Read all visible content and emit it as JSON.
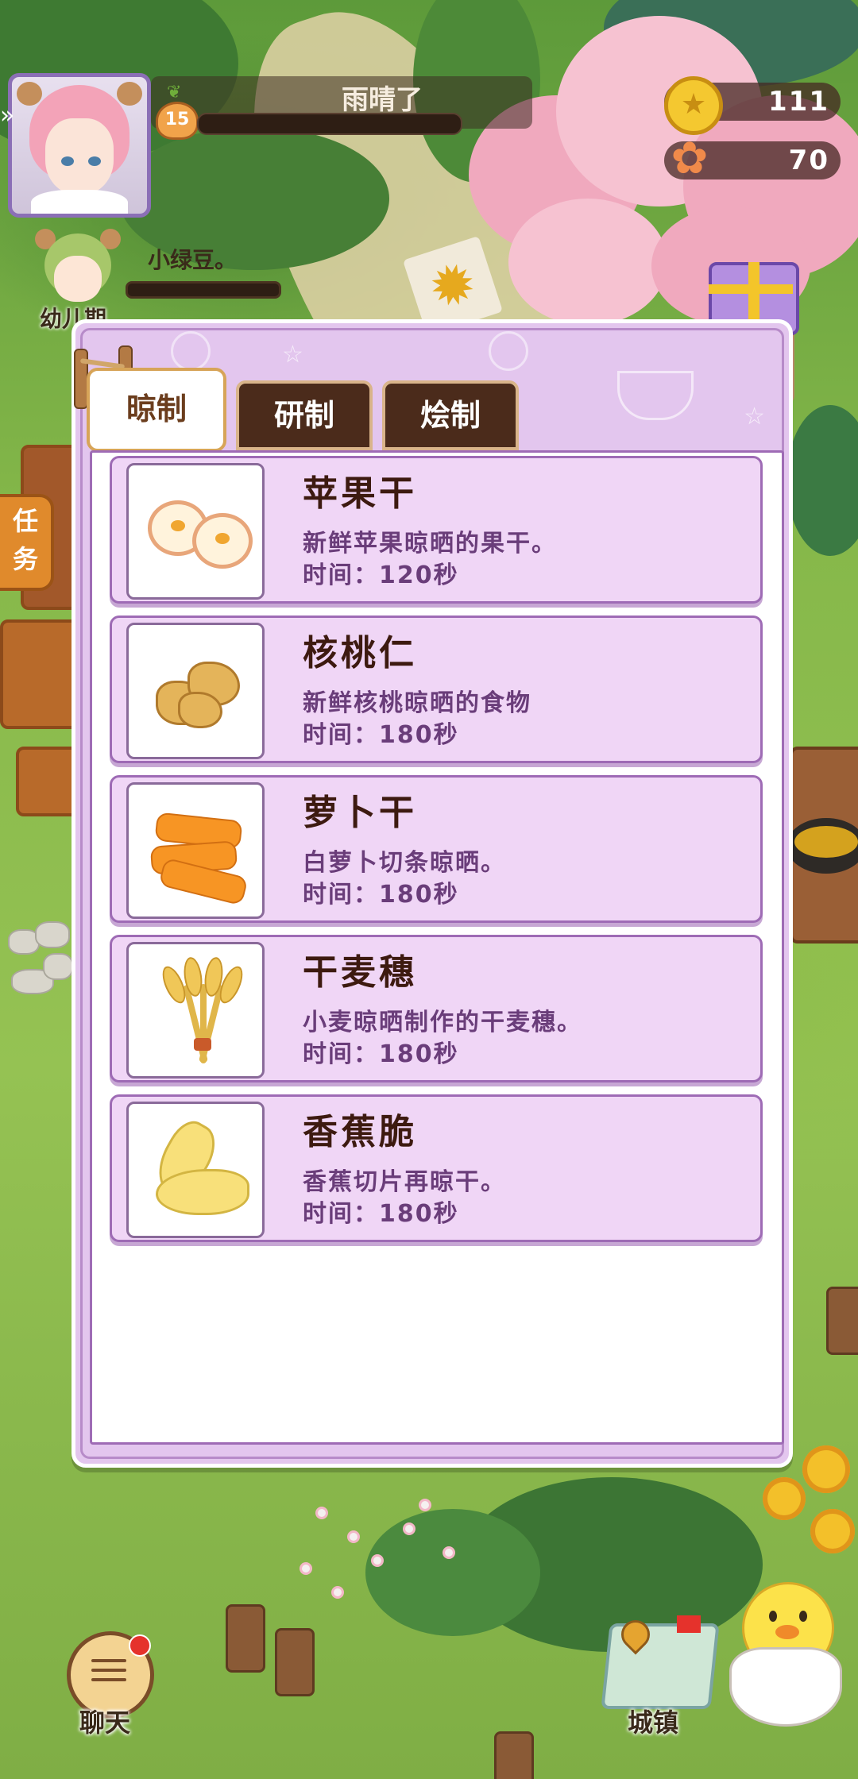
{
  "hud": {
    "weather": "雨晴了",
    "level": "15",
    "coins": "111",
    "flowers": "70"
  },
  "pet": {
    "name": "小绿豆。",
    "stage": "幼儿期",
    "growth": 0.0
  },
  "side": {
    "task_label": "任务"
  },
  "panel": {
    "tabs": [
      {
        "label": "晾制",
        "active": true
      },
      {
        "label": "研制",
        "active": false
      },
      {
        "label": "烩制",
        "active": false
      }
    ],
    "items": [
      {
        "name": "苹果干",
        "desc": "新鲜苹果晾晒的果干。",
        "time": "时间：120秒",
        "icon": "dried-apple-icon"
      },
      {
        "name": "核桃仁",
        "desc": "新鲜核桃晾晒的食物",
        "time": "时间：180秒",
        "icon": "walnut-icon"
      },
      {
        "name": "萝卜干",
        "desc": "白萝卜切条晾晒。",
        "time": "时间：180秒",
        "icon": "dried-carrot-icon"
      },
      {
        "name": "干麦穗",
        "desc": "小麦晾晒制作的干麦穗。",
        "time": "时间：180秒",
        "icon": "wheat-icon"
      },
      {
        "name": "香蕉脆",
        "desc": "香蕉切片再晾干。",
        "time": "时间：180秒",
        "icon": "banana-chips-icon"
      }
    ]
  },
  "bottom": {
    "chat_label": "聊天",
    "town_label": "城镇"
  }
}
